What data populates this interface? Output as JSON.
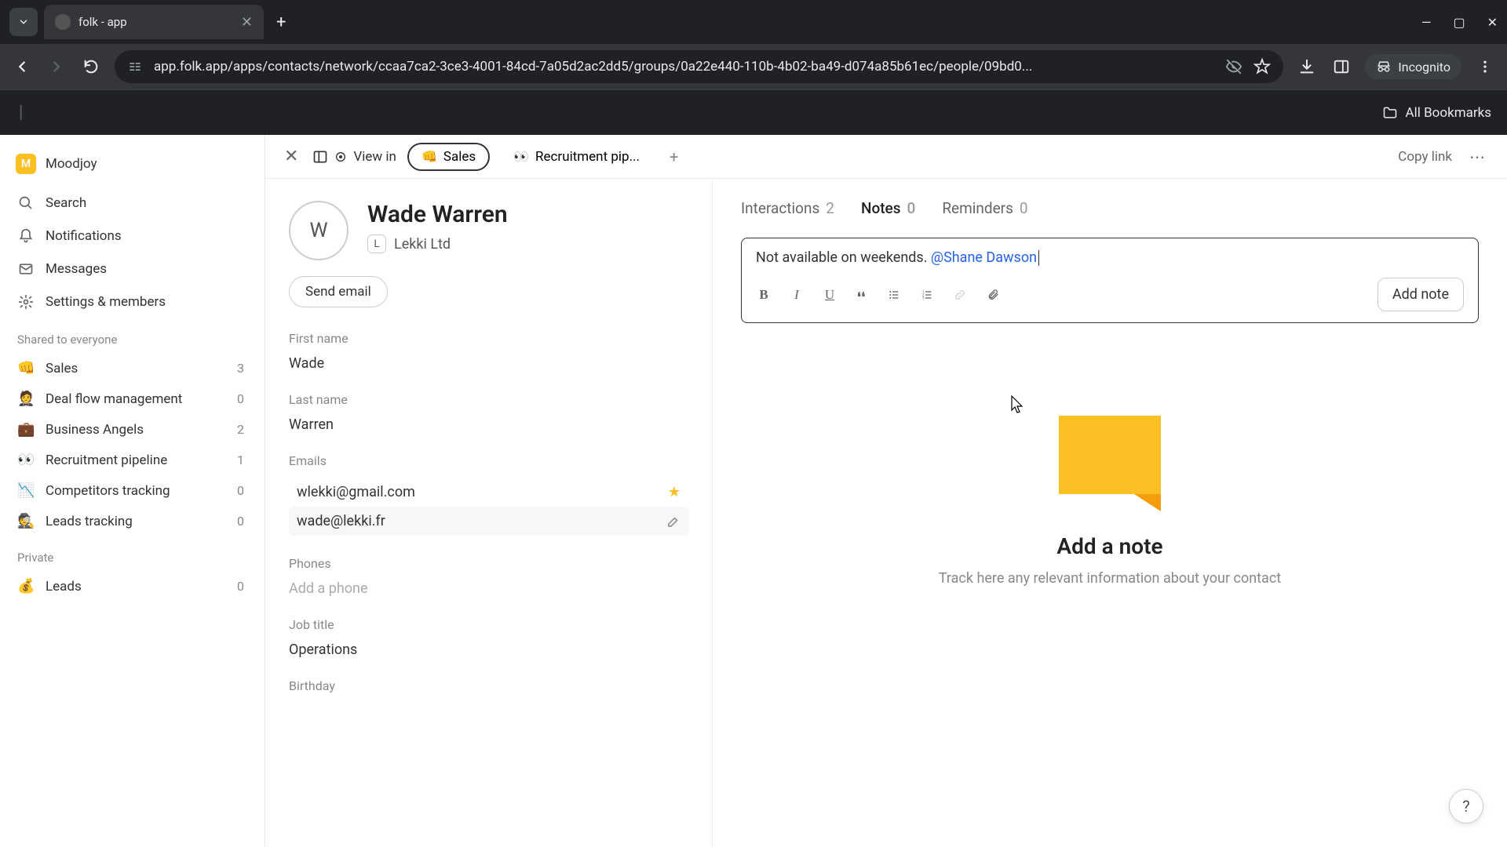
{
  "browser": {
    "tab_title": "folk - app",
    "url": "app.folk.app/apps/contacts/network/ccaa7ca2-3ce3-4001-84cd-7a05d2ac2dd5/groups/0a22e440-110b-4b02-ba49-d074a85b61ec/people/09bd0...",
    "incognito_label": "Incognito",
    "all_bookmarks": "All Bookmarks"
  },
  "sidebar": {
    "workspace_name": "Moodjoy",
    "search": "Search",
    "notifications": "Notifications",
    "messages": "Messages",
    "settings": "Settings & members",
    "shared_title": "Shared to everyone",
    "private_title": "Private",
    "groups": [
      {
        "emoji": "👊",
        "name": "Sales",
        "count": "3"
      },
      {
        "emoji": "🤵",
        "name": "Deal flow management",
        "count": "0"
      },
      {
        "emoji": "💼",
        "name": "Business Angels",
        "count": "2"
      },
      {
        "emoji": "👀",
        "name": "Recruitment pipeline",
        "count": "1"
      },
      {
        "emoji": "📉",
        "name": "Competitors tracking",
        "count": "0"
      },
      {
        "emoji": "🕵️",
        "name": "Leads tracking",
        "count": "0"
      }
    ],
    "private_groups": [
      {
        "emoji": "💰",
        "name": "Leads",
        "count": "0"
      }
    ]
  },
  "header": {
    "view_in": "View in",
    "pills": [
      {
        "emoji": "👊",
        "label": "Sales",
        "active": true
      },
      {
        "emoji": "👀",
        "label": "Recruitment pip...",
        "active": false
      }
    ],
    "copy_link": "Copy link"
  },
  "contact": {
    "avatar_initial": "W",
    "name": "Wade Warren",
    "company_initial": "L",
    "company": "Lekki Ltd",
    "send_email": "Send email",
    "fields": {
      "first_name_label": "First name",
      "first_name": "Wade",
      "last_name_label": "Last name",
      "last_name": "Warren",
      "emails_label": "Emails",
      "email1": "wlekki@gmail.com",
      "email2": "wade@lekki.fr",
      "phones_label": "Phones",
      "phones_placeholder": "Add a phone",
      "job_title_label": "Job title",
      "job_title": "Operations",
      "birthday_label": "Birthday"
    }
  },
  "right": {
    "tabs": [
      {
        "label": "Interactions",
        "count": "2"
      },
      {
        "label": "Notes",
        "count": "0"
      },
      {
        "label": "Reminders",
        "count": "0"
      }
    ],
    "note_text": "Not available on weekends. ",
    "note_mention": "@Shane Dawson",
    "add_note_btn": "Add note",
    "empty_title": "Add a note",
    "empty_subtitle": "Track here any relevant information about your contact"
  }
}
